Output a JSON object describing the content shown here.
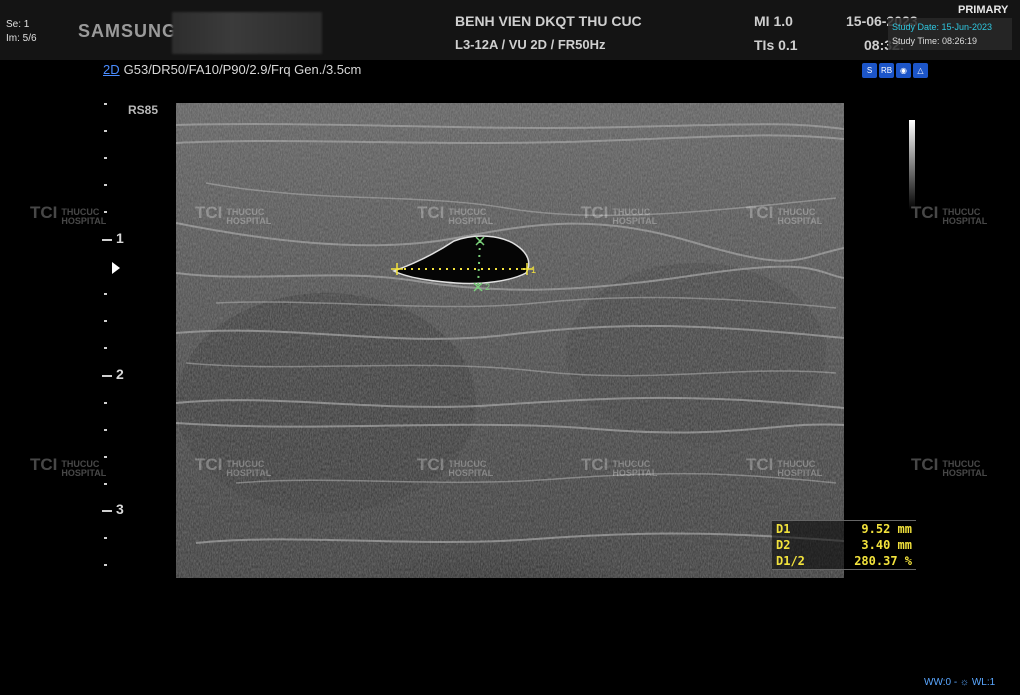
{
  "header": {
    "series": "Se: 1",
    "image": "Im: 5/6",
    "logo": "SAMSUNG",
    "hospital": "BENH VIEN DKQT THU CUC",
    "probe": "L3-12A / VU 2D / FR50Hz",
    "mi": "MI  1.0",
    "tis": "TIs  0.1",
    "date": "15-06-2023",
    "time": "08:32:",
    "primary": "PRIMARY",
    "study_date": "Study Date: 15-Jun-2023",
    "study_time": "Study Time: 08:26:19"
  },
  "params": {
    "mode": "2D",
    "text": "G53/DR50/FA10/P90/2.9/Frq Gen./3.5cm"
  },
  "icons": [
    "S",
    "RB",
    "eye-icon",
    "person-icon"
  ],
  "preset": "RS85",
  "depth_labels": [
    "1",
    "2",
    "3"
  ],
  "watermark": {
    "mark": "TCI",
    "line1": "THUCUC",
    "line2": "HOSPITAL"
  },
  "measurements": [
    {
      "label": "D1",
      "value": "9.52 mm"
    },
    {
      "label": "D2",
      "value": "3.40 mm"
    },
    {
      "label": "D1/2",
      "value": "280.37 %"
    }
  ],
  "calipers": {
    "d1_label": "1",
    "d2_label": "2"
  },
  "window_level": "WW:0  -  ☼ WL:1",
  "colors": {
    "caliper_d1": "#f2e23c",
    "caliper_d2": "#7ad07a",
    "accent": "#2fc7e0",
    "mode": "#4a8cff"
  }
}
